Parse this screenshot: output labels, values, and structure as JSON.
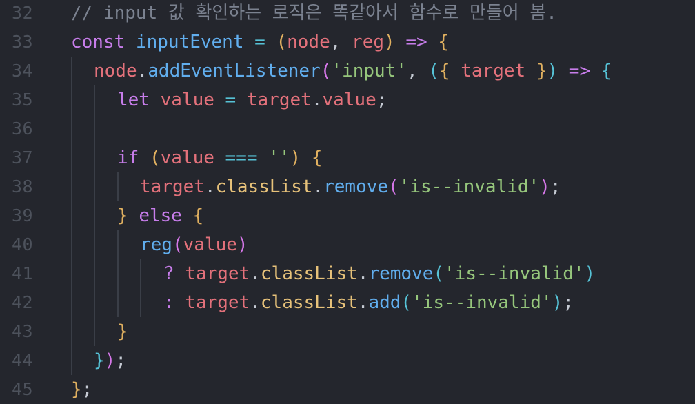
{
  "editor": {
    "line_numbers": [
      "32",
      "33",
      "34",
      "35",
      "36",
      "37",
      "38",
      "39",
      "40",
      "41",
      "42",
      "43",
      "44",
      "45"
    ],
    "lines": [
      [
        {
          "t": "// input 값 확인하는 로직은 똑같아서 함수로 만들어 봄.",
          "c": "comment"
        }
      ],
      [
        {
          "t": "const",
          "c": "keyword"
        },
        {
          "t": " ",
          "c": "punc"
        },
        {
          "t": "inputEvent",
          "c": "fn"
        },
        {
          "t": " = ",
          "c": "op"
        },
        {
          "t": "(",
          "c": "brace"
        },
        {
          "t": "node",
          "c": "var"
        },
        {
          "t": ", ",
          "c": "punc"
        },
        {
          "t": "reg",
          "c": "var"
        },
        {
          "t": ")",
          "c": "brace"
        },
        {
          "t": " => ",
          "c": "keyword"
        },
        {
          "t": "{",
          "c": "brace"
        }
      ],
      [
        {
          "t": "node",
          "c": "var"
        },
        {
          "t": ".",
          "c": "punc"
        },
        {
          "t": "addEventListener",
          "c": "fn"
        },
        {
          "t": "(",
          "c": "paren2"
        },
        {
          "t": "'input'",
          "c": "str"
        },
        {
          "t": ", ",
          "c": "punc"
        },
        {
          "t": "(",
          "c": "paren3"
        },
        {
          "t": "{",
          "c": "brace"
        },
        {
          "t": " target ",
          "c": "var"
        },
        {
          "t": "}",
          "c": "brace"
        },
        {
          "t": ")",
          "c": "paren3"
        },
        {
          "t": " => ",
          "c": "keyword"
        },
        {
          "t": "{",
          "c": "paren3"
        }
      ],
      [
        {
          "t": "let",
          "c": "keyword"
        },
        {
          "t": " ",
          "c": "punc"
        },
        {
          "t": "value",
          "c": "var"
        },
        {
          "t": " = ",
          "c": "op"
        },
        {
          "t": "target",
          "c": "var"
        },
        {
          "t": ".",
          "c": "punc"
        },
        {
          "t": "value",
          "c": "var"
        },
        {
          "t": ";",
          "c": "punc"
        }
      ],
      [],
      [
        {
          "t": "if",
          "c": "keyword"
        },
        {
          "t": " ",
          "c": "punc"
        },
        {
          "t": "(",
          "c": "brace"
        },
        {
          "t": "value",
          "c": "var"
        },
        {
          "t": " === ",
          "c": "op"
        },
        {
          "t": "''",
          "c": "str"
        },
        {
          "t": ")",
          "c": "brace"
        },
        {
          "t": " ",
          "c": "punc"
        },
        {
          "t": "{",
          "c": "brace"
        }
      ],
      [
        {
          "t": "target",
          "c": "var"
        },
        {
          "t": ".",
          "c": "punc"
        },
        {
          "t": "classList",
          "c": "prop"
        },
        {
          "t": ".",
          "c": "punc"
        },
        {
          "t": "remove",
          "c": "fn"
        },
        {
          "t": "(",
          "c": "paren2"
        },
        {
          "t": "'is--invalid'",
          "c": "str"
        },
        {
          "t": ")",
          "c": "paren2"
        },
        {
          "t": ";",
          "c": "punc"
        }
      ],
      [
        {
          "t": "}",
          "c": "brace"
        },
        {
          "t": " ",
          "c": "punc"
        },
        {
          "t": "else",
          "c": "keyword"
        },
        {
          "t": " ",
          "c": "punc"
        },
        {
          "t": "{",
          "c": "brace"
        }
      ],
      [
        {
          "t": "reg",
          "c": "fn"
        },
        {
          "t": "(",
          "c": "paren2"
        },
        {
          "t": "value",
          "c": "var"
        },
        {
          "t": ")",
          "c": "paren2"
        }
      ],
      [
        {
          "t": "? ",
          "c": "keyword"
        },
        {
          "t": "target",
          "c": "var"
        },
        {
          "t": ".",
          "c": "punc"
        },
        {
          "t": "classList",
          "c": "prop"
        },
        {
          "t": ".",
          "c": "punc"
        },
        {
          "t": "remove",
          "c": "fn"
        },
        {
          "t": "(",
          "c": "paren3"
        },
        {
          "t": "'is--invalid'",
          "c": "str"
        },
        {
          "t": ")",
          "c": "paren3"
        }
      ],
      [
        {
          "t": ": ",
          "c": "keyword"
        },
        {
          "t": "target",
          "c": "var"
        },
        {
          "t": ".",
          "c": "punc"
        },
        {
          "t": "classList",
          "c": "prop"
        },
        {
          "t": ".",
          "c": "punc"
        },
        {
          "t": "add",
          "c": "fn"
        },
        {
          "t": "(",
          "c": "paren3"
        },
        {
          "t": "'is--invalid'",
          "c": "str"
        },
        {
          "t": ")",
          "c": "paren3"
        },
        {
          "t": ";",
          "c": "punc"
        }
      ],
      [
        {
          "t": "}",
          "c": "brace"
        }
      ],
      [
        {
          "t": "}",
          "c": "paren3"
        },
        {
          "t": ")",
          "c": "paren2"
        },
        {
          "t": ";",
          "c": "punc"
        }
      ],
      [
        {
          "t": "}",
          "c": "brace"
        },
        {
          "t": ";",
          "c": "punc"
        }
      ]
    ],
    "colors": {
      "background": "#24262d",
      "line_number": "#4d525c",
      "comment": "#7b8290",
      "keyword": "#c77dea",
      "function": "#61aeee",
      "variable": "#e3717b",
      "string": "#96c67c",
      "brace": "#e0b060",
      "property": "#e7c27a"
    }
  }
}
